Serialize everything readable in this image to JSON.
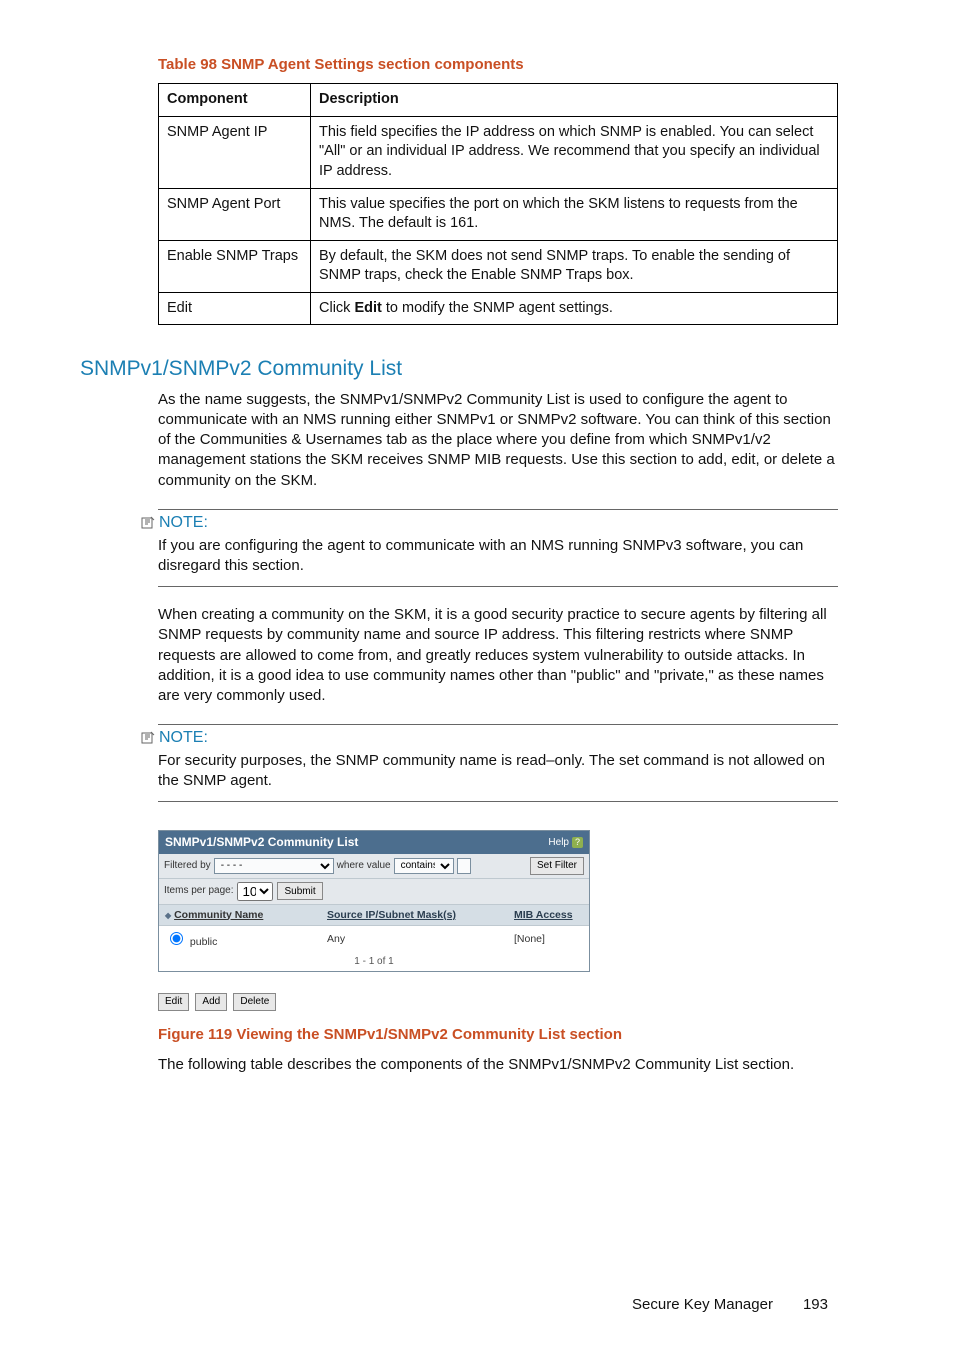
{
  "table98": {
    "caption": "Table 98 SNMP Agent Settings section components",
    "headers": {
      "c1": "Component",
      "c2": "Description"
    },
    "rows": [
      {
        "c1": "SNMP Agent IP",
        "c2": "This field specifies the IP address on which SNMP is enabled. You can select \"All\" or an individual IP address. We recommend that you specify an individual IP address."
      },
      {
        "c1": "SNMP Agent Port",
        "c2": "This value specifies the port on which the SKM listens to requests from the NMS. The default is 161."
      },
      {
        "c1": "Enable SNMP Traps",
        "c2": "By default, the SKM does not send SNMP traps. To enable the sending of SNMP traps, check the Enable SNMP Traps box."
      },
      {
        "c1": "Edit",
        "c2_pre": "Click ",
        "c2_bold": "Edit",
        "c2_post": " to modify the SNMP agent settings."
      }
    ]
  },
  "section": {
    "heading": "SNMPv1/SNMPv2 Community List",
    "para1": "As the name suggests, the SNMPv1/SNMPv2 Community List is used to configure the agent to communicate with an NMS running either SNMPv1 or SNMPv2 software. You can think of this section of the Communities & Usernames tab as the place where you define from which SNMPv1/v2 management stations the SKM receives SNMP MIB requests. Use this section to add, edit, or delete a community on the SKM.",
    "para2": "When creating a community on the SKM, it is a good security practice to secure agents by filtering all SNMP requests by community name and source IP address. This filtering restricts where SNMP requests are allowed to come from, and greatly reduces system vulnerability to outside attacks. In addition, it is a good idea to use community names other than \"public\" and \"private,\" as these names are very commonly used."
  },
  "note1": {
    "label": "NOTE:",
    "text": "If you are configuring the agent to communicate with an NMS running SNMPv3 software, you can disregard this section."
  },
  "note2": {
    "label": "NOTE:",
    "text": "For security purposes, the SNMP community name is read–only. The set command is not allowed on the SNMP agent."
  },
  "ui": {
    "title": "SNMPv1/SNMPv2 Community List",
    "help": "Help",
    "help_badge": "?",
    "filtered_by": "Filtered by",
    "filter_field_value": "- - - -",
    "where_value": "where value",
    "contains": "contains",
    "set_filter": "Set Filter",
    "items_per_page": "Items per page:",
    "items_value": "10",
    "submit": "Submit",
    "col_community": "Community Name",
    "col_source": "Source IP/Subnet Mask(s)",
    "col_mib": "MIB Access",
    "row": {
      "community": "public",
      "source": "Any",
      "mib": "[None]"
    },
    "pager": "1 - 1 of 1",
    "edit": "Edit",
    "add": "Add",
    "delete": "Delete"
  },
  "figure": {
    "caption": "Figure 119 Viewing the SNMPv1/SNMPv2 Community List section",
    "following": "The following table describes the components of the SNMPv1/SNMPv2 Community List section."
  },
  "footer": {
    "product": "Secure Key Manager",
    "page": "193"
  }
}
